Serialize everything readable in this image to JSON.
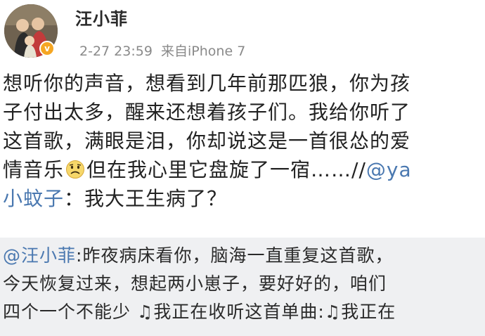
{
  "author": {
    "name": "汪小菲",
    "timestamp": "2-27 23:59",
    "source": "来自iPhone 7",
    "verified_icon": "verified-badge-icon"
  },
  "post": {
    "line1": "想听你的声音，想看到几年前那匹狼，你为孩",
    "line2": "子付出太多，醒来还想着孩子们。我给你听了",
    "line3": "这首歌，满眼是泪，你却说这是一首很怂的爱",
    "line4_a": "情音乐",
    "emoji": "sad-face-emoji",
    "line4_b": "但在我心里它盘旋了一宿……//",
    "mention1": "@ya",
    "mention2": "小蚊子",
    "line5_b": "：我大王生病了？"
  },
  "repost": {
    "mention": "@汪小菲",
    "line1_rest": ":昨夜病床看你，脑海一直重复这首歌，",
    "line2": "今天恢复过来，想起两小崽子，要好好的，咱们",
    "line3_a": "四个一个不能少 ",
    "note1": "♫",
    "line3_b": "我正在收听这首单曲:",
    "note2": "♫",
    "line3_c": "我正在"
  },
  "colors": {
    "mention": "#4a78b0",
    "repost_bg": "#eff0f2",
    "meta": "#8a8a8a"
  }
}
